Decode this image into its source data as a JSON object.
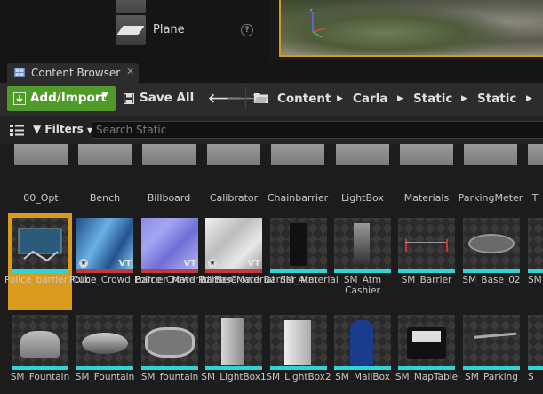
{
  "place_panel": {
    "item_label": "Plane"
  },
  "tab": {
    "title": "Content Browser"
  },
  "toolbar": {
    "add_import_label": "Add/Import",
    "save_all_label": "Save All",
    "breadcrumbs": [
      "Content",
      "Carla",
      "Static",
      "Static"
    ]
  },
  "filter_bar": {
    "filters_label": "Filters",
    "search_placeholder": "Search Static",
    "search_value": ""
  },
  "folders": [
    {
      "label": "00_Opt"
    },
    {
      "label": "Bench"
    },
    {
      "label": "Billboard"
    },
    {
      "label": "Calibrator"
    },
    {
      "label": "Chainbarrier"
    },
    {
      "label": "LightBox"
    },
    {
      "label": "Materials"
    },
    {
      "label": "ParkingMeter"
    },
    {
      "label": "T"
    }
  ],
  "assets_row1": [
    {
      "label": "Police_barrier_Cube",
      "selected": true
    },
    {
      "label": "Police_Crowd_Barrier_Material_Base",
      "badge": "VT"
    },
    {
      "label": "Police_Crowd_Barrier_Material",
      "badge": "VT"
    },
    {
      "label": "Police_Crowd_Barrier_Material",
      "badge": "VT"
    },
    {
      "label": "SM_Atm"
    },
    {
      "label": "SM_Atm Cashier"
    },
    {
      "label": "SM_Barrier"
    },
    {
      "label": "SM_Base_02"
    },
    {
      "label": "SM"
    }
  ],
  "assets_row2": [
    {
      "label": "SM_Fountain"
    },
    {
      "label": "SM_Fountain"
    },
    {
      "label": "SM_fountain"
    },
    {
      "label": "SM_LightBox1"
    },
    {
      "label": "SM_LightBox2"
    },
    {
      "label": "SM_MailBox"
    },
    {
      "label": "SM_MapTable"
    },
    {
      "label": "SM_Parking"
    },
    {
      "label": "S"
    }
  ],
  "colors": {
    "accent_green": "#4f9a29",
    "selection_orange": "#d99a1e",
    "static_mesh_bar": "#2fd4d8",
    "material_bar": "#c23a3a"
  }
}
